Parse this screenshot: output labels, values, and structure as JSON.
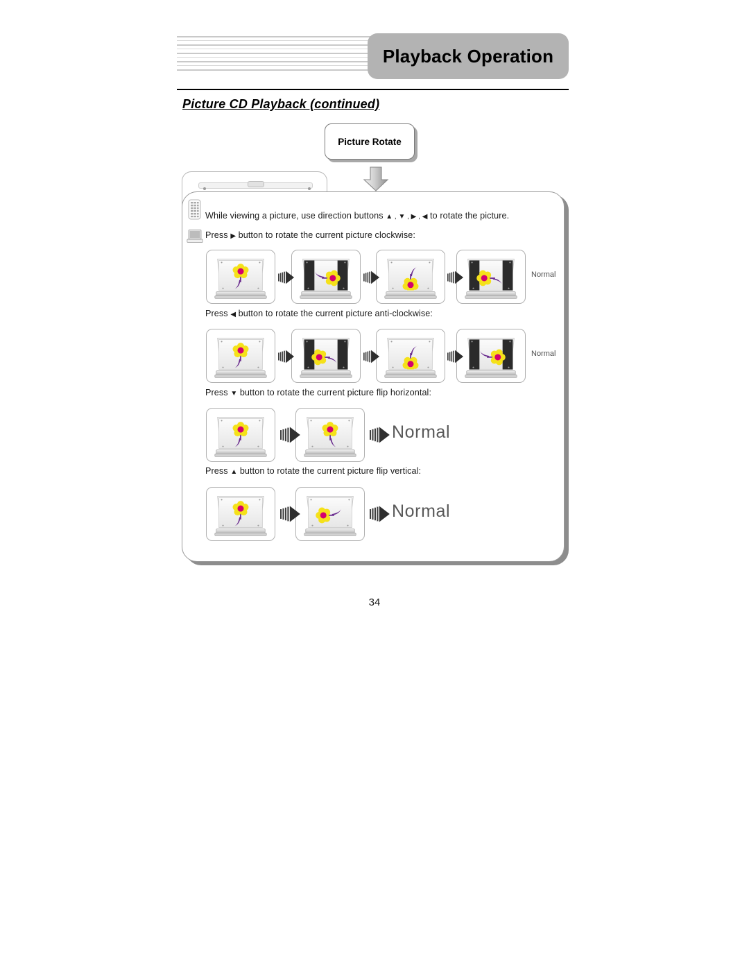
{
  "header": {
    "title": "Playback Operation",
    "subtitle": "Picture CD Playback (continued)"
  },
  "callout": {
    "label": "Picture Rotate",
    "arrow_icon": "down-arrow-icon"
  },
  "icons": {
    "remote": "remote-control-icon",
    "display": "tv-monitor-icon",
    "sequence_arrow": "motion-arrow-icon"
  },
  "instructions": [
    {
      "id": "intro",
      "text_before": "While viewing a picture, use direction buttons",
      "glyphs": "▲ , ▼ , ▶ , ◀",
      "text_after": "to rotate the picture."
    },
    {
      "id": "clockwise",
      "text_before": "Press",
      "glyphs": "▶",
      "text_after": "button to rotate the current picture clockwise:"
    },
    {
      "id": "anti-clockwise",
      "text_before": "Press",
      "glyphs": "◀",
      "text_after": "button to rotate the current picture anti-clockwise:"
    },
    {
      "id": "flip-horizontal",
      "text_before": "Press",
      "glyphs": "▼",
      "text_after": "button to rotate the current picture flip horizontal:"
    },
    {
      "id": "flip-vertical",
      "text_before": "Press",
      "glyphs": "▲",
      "text_after": "button to rotate the current picture flip vertical:"
    }
  ],
  "sequences": [
    {
      "id": "clockwise-sequence",
      "end_label": "Normal",
      "end_label_size": "small",
      "frames": [
        {
          "rotation": 0,
          "letterbox": false
        },
        {
          "rotation": 90,
          "letterbox": true
        },
        {
          "rotation": 180,
          "letterbox": false
        },
        {
          "rotation": 270,
          "letterbox": true
        }
      ]
    },
    {
      "id": "anti-clockwise-sequence",
      "end_label": "Normal",
      "end_label_size": "small",
      "frames": [
        {
          "rotation": 0,
          "letterbox": false
        },
        {
          "rotation": -90,
          "letterbox": true
        },
        {
          "rotation": -180,
          "letterbox": false
        },
        {
          "rotation": -270,
          "letterbox": true
        }
      ]
    },
    {
      "id": "flip-horizontal-sequence",
      "end_label": "Normal",
      "end_label_size": "large",
      "frames": [
        {
          "rotation": 0,
          "letterbox": false
        },
        {
          "rotation": 0,
          "letterbox": false,
          "flip": "horizontal"
        }
      ]
    },
    {
      "id": "flip-vertical-sequence",
      "end_label": "Normal",
      "end_label_size": "large",
      "frames": [
        {
          "rotation": 0,
          "letterbox": false
        },
        {
          "rotation": 90,
          "letterbox": false,
          "flip": "vertical"
        }
      ]
    }
  ],
  "footer": {
    "page_number": "34"
  },
  "colors": {
    "header_box": "#b3b3b3",
    "panel_border": "#9a9a9a",
    "flower_petal": "#f5e11a",
    "flower_center": "#d4006e",
    "flower_stem": "#6b2d8f"
  }
}
